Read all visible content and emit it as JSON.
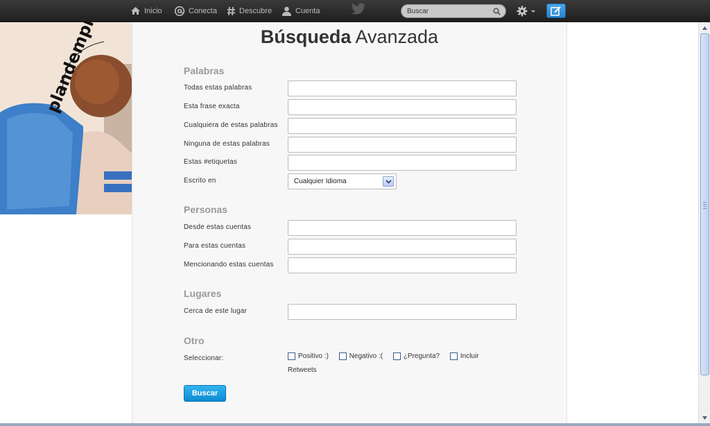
{
  "nav": {
    "home": "Inicio",
    "connect": "Conecta",
    "discover": "Descubre",
    "account": "Cuenta",
    "search_placeholder": "Buscar"
  },
  "title": {
    "bold": "Búsqueda",
    "light": "Avanzada"
  },
  "sections": {
    "words": {
      "title": "Palabras",
      "all_words": "Todas estas palabras",
      "exact_phrase": "Esta frase exacta",
      "any_words": "Cualquiera de estas palabras",
      "none_words": "Ninguna de estas palabras",
      "hashtags": "Estas #etiquetas",
      "language_label": "Escrito en",
      "language_value": "Cualquier Idioma"
    },
    "people": {
      "title": "Personas",
      "from": "Desde estas cuentas",
      "to": "Para estas cuentas",
      "mentioning": "Mencionando estas cuentas"
    },
    "places": {
      "title": "Lugares",
      "near": "Cerca de este lugar"
    },
    "other": {
      "title": "Otro",
      "select_label": "Seleccionar:",
      "positive": "Positivo :)",
      "negative": "Negativo :(",
      "question": "¿Pregunta?",
      "include": "Incluir",
      "retweets": "Retweets"
    }
  },
  "submit": "Buscar",
  "colors": {
    "topbar": "#262626",
    "accent": "#1a9ee0",
    "compose": "#2a85d0"
  }
}
